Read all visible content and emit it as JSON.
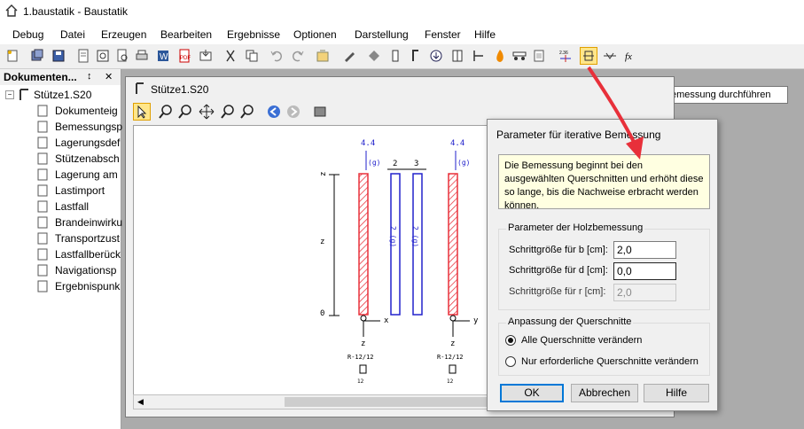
{
  "window": {
    "title": "1.baustatik - Baustatik"
  },
  "menu": [
    "Debug",
    "Datei",
    "Erzeugen",
    "Bearbeiten",
    "Ergebnisse",
    "Optionen",
    "Darstellung",
    "Fenster",
    "Hilfe"
  ],
  "tooltip": "Holz- oder Stahlbemessung durchführen",
  "doc_panel": {
    "title": "Dokumenten...",
    "pin": "↕",
    "close": "✕",
    "root": "Stütze1.S20",
    "items": [
      "Dokumenteig",
      "Bemessungsp",
      "Lagerungsdef",
      "Stützenabsch",
      "Lagerung am",
      "Lastimport",
      "Lastfall",
      "Brandeinwirku",
      "Transportzust",
      "Lastfallberück",
      "Navigationsp",
      "Ergebnispunk"
    ]
  },
  "child_window": {
    "title": "Stütze1.S20"
  },
  "drawing": {
    "left_top_load": "4.4",
    "right_top_load": "4.4",
    "load_g": "(g)",
    "column_labels": [
      "2",
      "3"
    ],
    "ticks_z": [
      "z",
      "z",
      "0"
    ],
    "axis_x": "x",
    "axis_y": "y",
    "axis_z": "z",
    "section_labels": [
      "R-12/12",
      "R-12/12"
    ],
    "section_dims": [
      "12",
      "12"
    ],
    "bar_text": "2 (g)"
  },
  "dialog": {
    "title": "Parameter für iterative Bemessung",
    "info": "Die Bemessung beginnt bei den ausgewählten Querschnitten und erhöht diese so lange, bis die Nachweise erbracht werden können.",
    "holz_group": "Parameter der Holzbemessung",
    "field_b_label": "Schrittgröße für b [cm]:",
    "field_b_value": "2,0",
    "field_d_label": "Schrittgröße für d [cm]:",
    "field_d_value": "0,0",
    "field_r_label": "Schrittgröße für r [cm]:",
    "field_r_value": "2,0",
    "querschnitte_group": "Anpassung der Querschnitte",
    "radio_all": "Alle Querschnitte verändern",
    "radio_needed": "Nur erforderliche Querschnitte verändern",
    "ok": "OK",
    "cancel": "Abbrechen",
    "help": "Hilfe"
  },
  "colors": {
    "accent_red": "#e8303a",
    "blue": "#2222cc",
    "highlight": "#ffe68a"
  }
}
